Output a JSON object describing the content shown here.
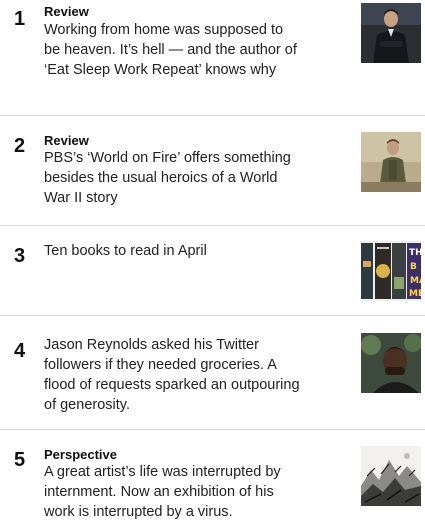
{
  "items": [
    {
      "rank": "1",
      "kicker": "Review",
      "headline": "Working from home was supposed to be heaven. It’s hell — and the author of ‘Eat Sleep Work Repeat’ knows why",
      "thumbnail": "man-in-dark-suit-photo"
    },
    {
      "rank": "2",
      "kicker": "Review",
      "headline": "PBS’s ‘World on Fire’ offers something besides the usual heroics of a World War II story",
      "thumbnail": "soldier-in-uniform-photo"
    },
    {
      "rank": "3",
      "kicker": "",
      "headline": "Ten books to read in April",
      "thumbnail": "book-covers-photo"
    },
    {
      "rank": "4",
      "kicker": "",
      "headline": "Jason Reynolds asked his Twitter followers if they needed groceries. A flood of requests sparked an outpouring of generosity.",
      "thumbnail": "author-portrait-photo"
    },
    {
      "rank": "5",
      "kicker": "Perspective",
      "headline": "A great artist’s life was interrupted by internment. Now an exhibition of his work is interrupted by a virus.",
      "thumbnail": "ink-landscape-painting"
    }
  ],
  "colors": {
    "text": "#111111",
    "divider": "#d9d9d9"
  }
}
